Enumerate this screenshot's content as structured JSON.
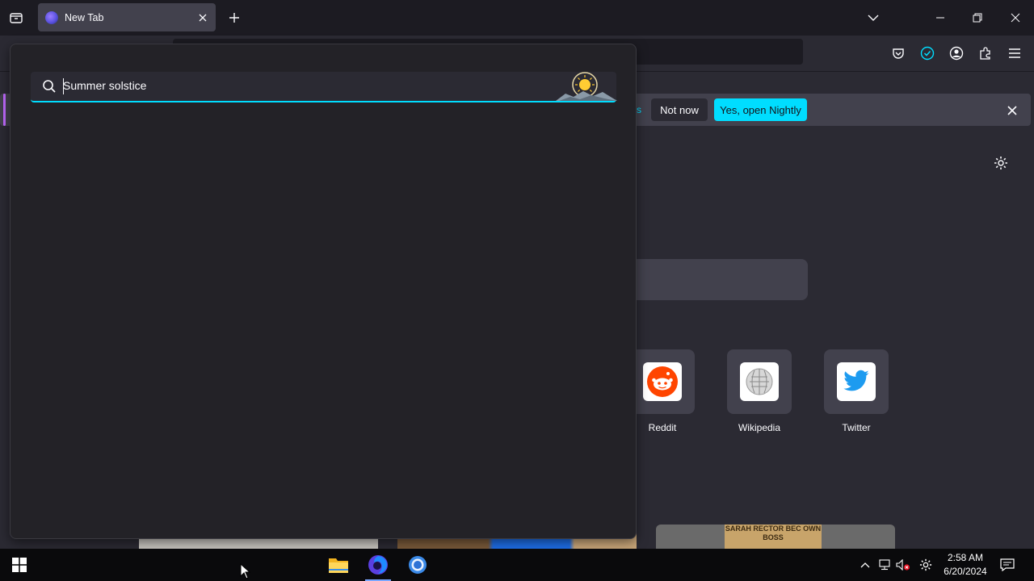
{
  "browser": {
    "tab": {
      "title": "New Tab",
      "favicon": "firefox-nightly-icon"
    },
    "toolbar_icons": [
      "pocket-icon",
      "sync-check-icon",
      "account-icon",
      "extensions-icon",
      "menu-icon"
    ]
  },
  "notification": {
    "message_fragment": "s",
    "not_now_label": "Not now",
    "open_label": "Yes, open Nightly"
  },
  "search_dropdown": {
    "query": "Summer solstice",
    "logo": "summer-solstice-logo"
  },
  "top_sites": [
    {
      "label": "Reddit",
      "icon": "reddit-icon"
    },
    {
      "label": "Wikipedia",
      "icon": "wikipedia-icon"
    },
    {
      "label": "Twitter",
      "icon": "twitter-icon"
    }
  ],
  "story": {
    "sign_text": "SARAH RECTOR BEC OWN BOSS"
  },
  "taskbar": {
    "apps": [
      "file-explorer-icon",
      "firefox-icon",
      "chrome-icon"
    ],
    "time": "2:58 AM",
    "date": "6/20/2024"
  },
  "colors": {
    "accent": "#00ddff",
    "page_bg": "#2b2a33",
    "tab_bar_bg": "#1c1b22",
    "dropdown_bg": "#232227",
    "notification_accent": "#c069ff"
  }
}
